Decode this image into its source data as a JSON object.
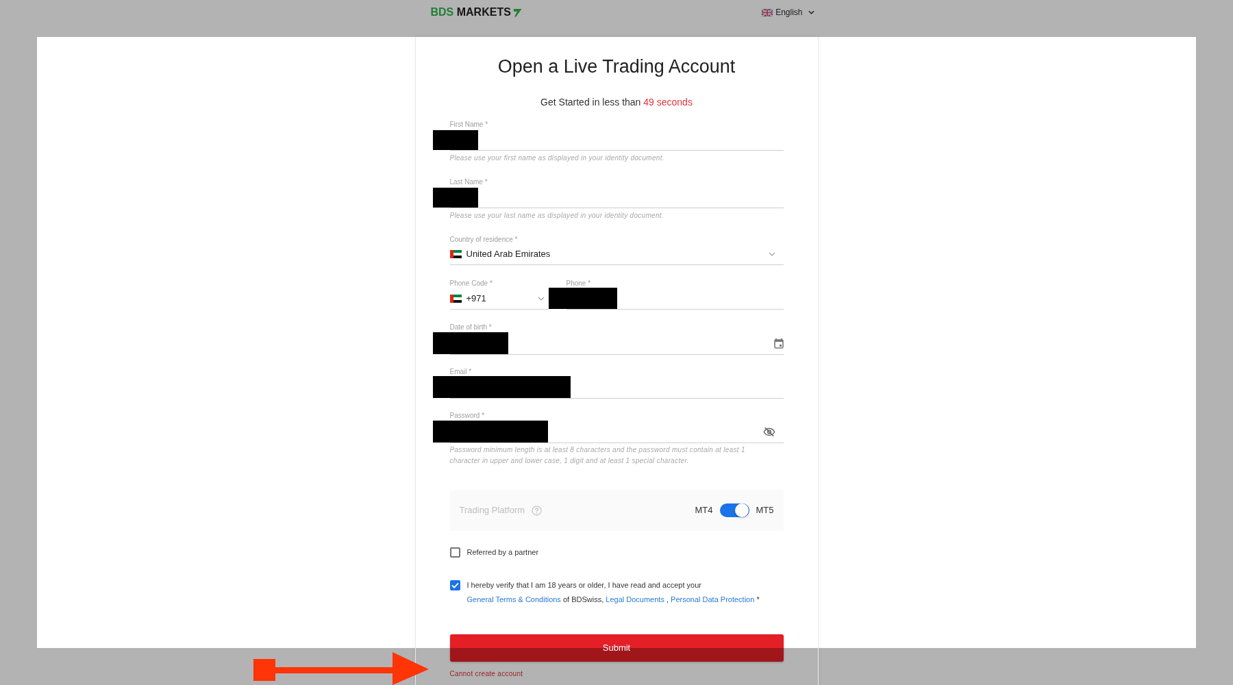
{
  "header": {
    "logo": {
      "accent": "BDS",
      "text": "MARKETS"
    },
    "language": {
      "label": "English"
    }
  },
  "form": {
    "title": "Open a Live Trading Account",
    "subtitle": {
      "text": "Get Started in less than",
      "highlight": "49 seconds"
    },
    "fields": [
      {
        "kind": "text",
        "label": "First Name *",
        "redacted": true,
        "hint": "Please use your first name as displayed in your identity document."
      },
      {
        "kind": "text",
        "label": "Last Name *",
        "redacted": true,
        "hint": "Please use your last name as displayed in your identity document."
      },
      {
        "kind": "country",
        "label": "Country of residence *",
        "value": "United Arab Emirates"
      },
      {
        "kind": "phone",
        "code_label": "Phone Code *",
        "code_value": "+971",
        "label": "Phone *",
        "redacted": true
      },
      {
        "kind": "date",
        "label": "Date of birth *",
        "redacted": true
      },
      {
        "kind": "text",
        "label": "Email *",
        "redacted": true
      },
      {
        "kind": "password",
        "label": "Password *",
        "redacted": true,
        "hint": "Password minimum length is at least 8 characters and the password must contain at least 1 character in upper and lower case, 1 digit and at least 1 special character."
      }
    ],
    "platform": {
      "label": "Trading Platform",
      "off_label": "MT4",
      "on_label": "MT5",
      "on": true
    },
    "checkboxes": [
      {
        "kind": "plain",
        "label": "Referred by a partner",
        "checked": false
      },
      {
        "kind": "terms",
        "checked": true,
        "segments": [
          {
            "kind": "text",
            "text": "I hereby verify that I am 18 years or older, I have read and accept your "
          },
          {
            "kind": "link",
            "text": "General Terms & Conditions"
          },
          {
            "kind": "text",
            "text": " of BDSwiss, "
          },
          {
            "kind": "link",
            "text": "Legal Documents"
          },
          {
            "kind": "text",
            "text": " , "
          },
          {
            "kind": "link",
            "text": "Personal Data Protection"
          },
          {
            "kind": "text",
            "text": " *"
          }
        ]
      }
    ],
    "submit": {
      "label": "Submit"
    },
    "error": "Cannot create account"
  }
}
